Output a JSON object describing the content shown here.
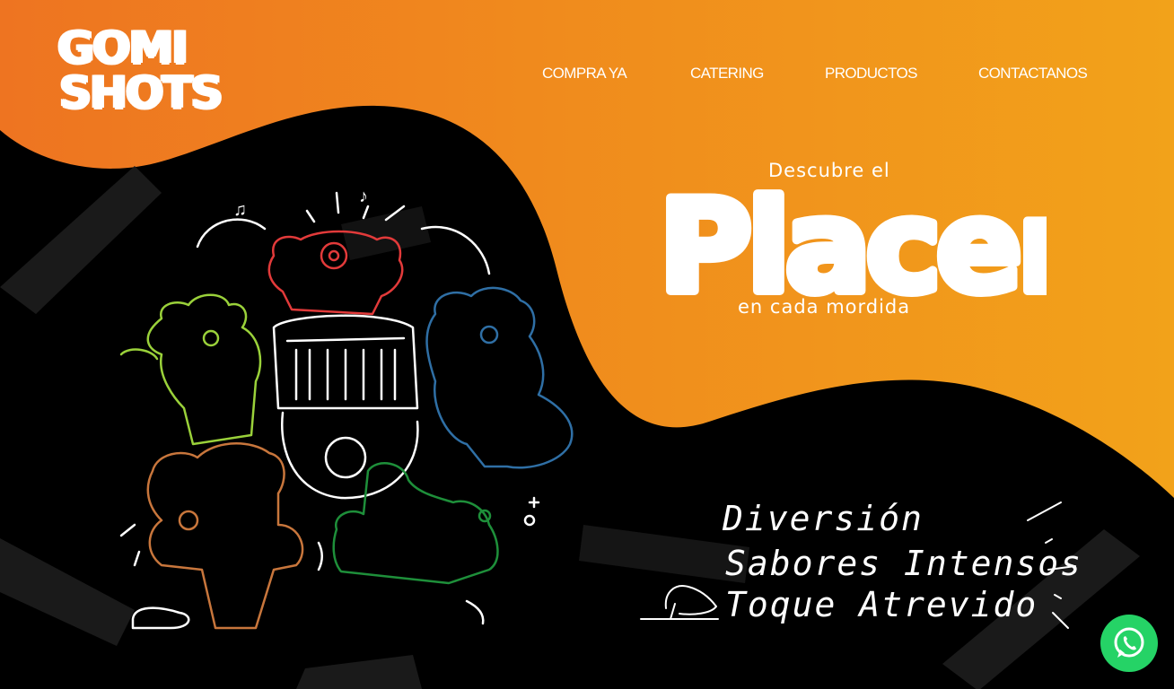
{
  "brand": {
    "logo_line1": "GOMI",
    "logo_line2": "SHOTS",
    "colors": {
      "orange_dark": "#ee7a20",
      "orange_light": "#f2a11a",
      "black": "#000000",
      "white": "#ffffff",
      "whatsapp_green": "#25d366"
    }
  },
  "nav": {
    "items": [
      "COMPRA YA",
      "CATERING",
      "PRODUCTOS",
      "CONTACTANOS"
    ]
  },
  "hero": {
    "pre": "Descubre el",
    "word": "Placer",
    "post": "en cada mordida"
  },
  "taglines": [
    "Diversión",
    "Sabores Intensos",
    "Toque Atrevido"
  ],
  "illustration": {
    "subject": "gummy bears party drawing",
    "bear_colors": [
      "#e23a3a",
      "#9ad13a",
      "#2f6fa5",
      "#c8763c",
      "#1e8f3a"
    ]
  },
  "whatsapp": {
    "icon": "whatsapp-icon"
  }
}
